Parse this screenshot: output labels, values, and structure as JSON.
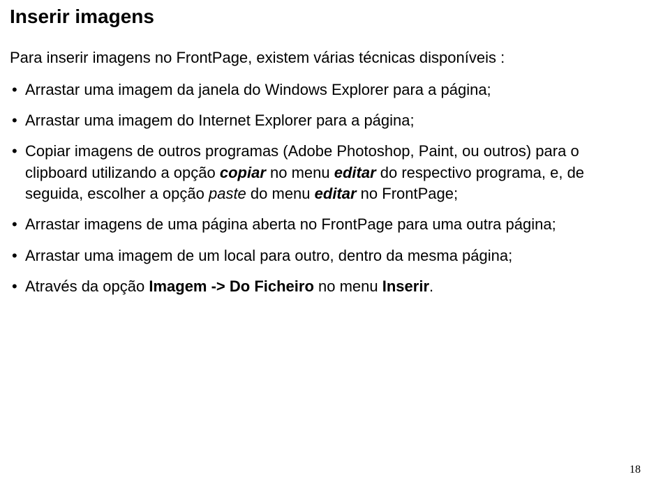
{
  "title": "Inserir imagens",
  "intro": "Para inserir imagens no FrontPage, existem várias técnicas disponíveis :",
  "bullets": {
    "b1": "Arrastar uma imagem da janela do Windows Explorer para a página;",
    "b2": "Arrastar uma imagem do Internet Explorer para a página;",
    "b3a": "Copiar imagens de outros programas (Adobe Photoshop, Paint, ou outros) para o clipboard utilizando a opção ",
    "b3_copiar": "copiar",
    "b3b": " no menu ",
    "b3_editar1": "editar",
    "b3c": " do respectivo programa, e, de seguida, escolher a opção ",
    "b3_paste": "paste",
    "b3d": " do menu ",
    "b3_editar2": "editar",
    "b3e": " no FrontPage;",
    "b4": "Arrastar imagens de uma página aberta no FrontPage para uma outra página;",
    "b5": "Arrastar uma imagem de um local para outro, dentro da mesma página;",
    "b6a": "Através da opção ",
    "b6_imagem": "Imagem -> Do Ficheiro",
    "b6b": " no menu ",
    "b6_inserir": "Inserir",
    "b6c": "."
  },
  "pageNumber": "18"
}
